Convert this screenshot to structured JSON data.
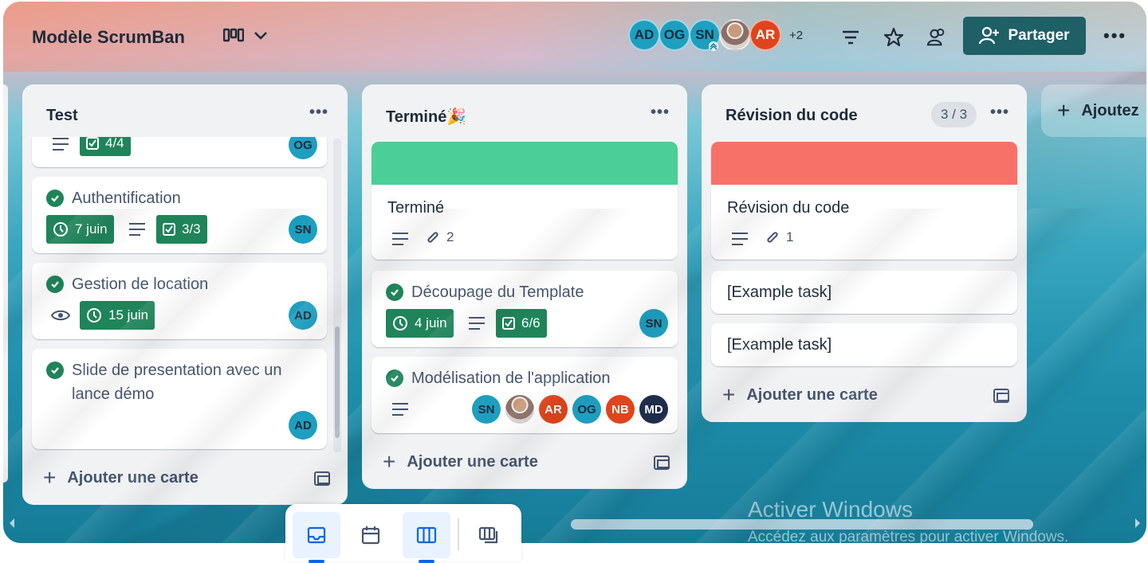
{
  "board": {
    "title": "Modèle ScrumBan"
  },
  "header": {
    "members": [
      {
        "initials": "AD",
        "color": "#1d9fc0"
      },
      {
        "initials": "OG",
        "color": "#1d9fc0"
      },
      {
        "initials": "SN",
        "color": "#1d9fc0"
      },
      {
        "initials": "",
        "color": "photo"
      },
      {
        "initials": "AR",
        "color": "#e0441c"
      }
    ],
    "extra_members": "+2",
    "share_label": "Partager"
  },
  "lists": {
    "test": {
      "title": "Test",
      "cards": [
        {
          "checklist": "4/4",
          "member": "OG"
        },
        {
          "title": "Authentification",
          "due": "7 juin",
          "checklist": "3/3",
          "member": "SN"
        },
        {
          "title": "Gestion de location",
          "due": "15 juin",
          "member": "AD"
        },
        {
          "title_line1": "Slide de presentation avec un",
          "title_line2": "lance démo",
          "member": "AD"
        }
      ],
      "add_label": "Ajouter une carte"
    },
    "done": {
      "title": "Terminé🎉",
      "cover_color": "#4bce97",
      "cards": [
        {
          "title": "Terminé",
          "attachments": "2"
        },
        {
          "title": "Découpage du Template",
          "due": "4 juin",
          "checklist": "6/6",
          "member": "SN"
        },
        {
          "title": "Modélisation de l'application",
          "members": [
            "SN",
            "",
            "AR",
            "OG",
            "NB",
            "MD"
          ]
        }
      ],
      "add_label": "Ajouter une carte"
    },
    "review": {
      "title": "Révision du code",
      "counter": "3 / 3",
      "cover_color": "#f87168",
      "cards": [
        {
          "title": "Révision du code",
          "attachments": "1"
        },
        {
          "title": "[Example task]"
        },
        {
          "title": "[Example task]"
        }
      ],
      "add_label": "Ajouter une carte"
    },
    "add_list": {
      "label": "Ajoutez"
    }
  },
  "watermark": {
    "line1": "Activer Windows",
    "line2": "Accédez aux paramètres pour activer Windows."
  }
}
